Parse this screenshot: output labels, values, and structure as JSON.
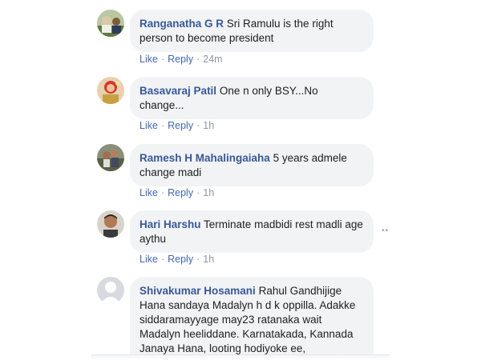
{
  "comments": [
    {
      "author": "Ranganatha G R",
      "text": "Sri Ramulu is the right person to become president",
      "actions": {
        "like": "Like",
        "reply": "Reply",
        "time": "24m"
      },
      "avatar_icon": "avatar-photo-icon"
    },
    {
      "author": "Basavaraj Patil",
      "text": "One n only BSY...No change...",
      "actions": {
        "like": "Like",
        "reply": "Reply",
        "time": "1h"
      },
      "avatar_icon": "avatar-photo-icon"
    },
    {
      "author": "Ramesh H Mahalingaiaha",
      "text": "5 years admele change madi",
      "actions": {
        "like": "Like",
        "reply": "Reply",
        "time": "1h"
      },
      "avatar_icon": "avatar-photo-icon"
    },
    {
      "author": "Hari Harshu",
      "text": "Terminate madbidi rest madli age aythu",
      "actions": {
        "like": "Like",
        "reply": "Reply",
        "time": "1h"
      },
      "avatar_icon": "avatar-photo-icon",
      "options_icon": "more-options-icon"
    },
    {
      "author": "Shivakumar Hosamani",
      "text": "Rahul Gandhijige Hana sandaya Madalyn h d k oppilla. Adakke siddaramayyage may23 ratanaka wait Madalyn heeliddane. Karnatakada, Kannada Janaya Hana, looting hodiyoke ee,",
      "avatar_icon": "default-avatar-icon"
    }
  ],
  "separator": "·",
  "options_glyph": "••"
}
